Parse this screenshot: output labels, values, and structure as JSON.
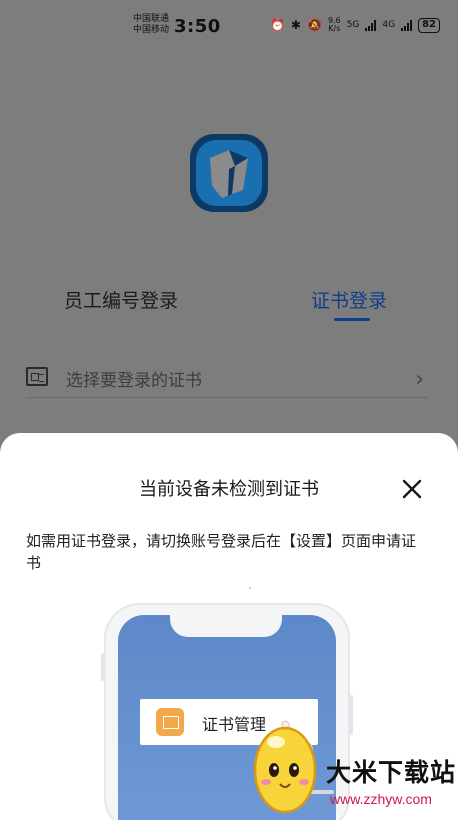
{
  "status_bar": {
    "carrier_1": "中国联通",
    "carrier_2": "中国移动",
    "time": "3:50",
    "net_speed_value": "9.6",
    "net_speed_unit": "K/s",
    "network_1": "5G",
    "network_2": "4G",
    "battery": "82"
  },
  "login": {
    "tab_employee": "员工编号登录",
    "tab_certificate": "证书登录",
    "active_tab": "证书登录",
    "cert_select_placeholder": "选择要登录的证书"
  },
  "sheet": {
    "title": "当前设备未检测到证书",
    "description": "如需用证书登录，请切换账号登录后在【设置】页面申请证书",
    "illustration_menu_label": "证书管理"
  },
  "watermark": {
    "brand": "大米下载站",
    "url": "www.zzhyw.com"
  },
  "colors": {
    "accent": "#0f3f86",
    "logo_blue": "#1a6fb0",
    "overlay": "#7d7d7d",
    "phone_screen": "#5d88c9",
    "icon_orange": "#f3a94a",
    "watermark_url": "#d4145a"
  }
}
